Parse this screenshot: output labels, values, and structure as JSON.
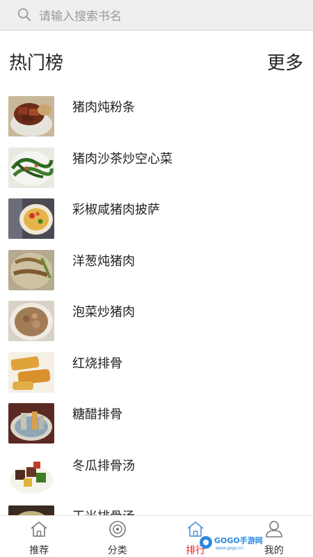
{
  "search": {
    "placeholder": "请输入搜索书名",
    "icon": "search-icon"
  },
  "section": {
    "title": "热门榜",
    "more": "更多"
  },
  "list": [
    {
      "title": "猪肉炖粉条",
      "thumb": "stewed-pork-glass-noodles"
    },
    {
      "title": "猪肉沙茶炒空心菜",
      "thumb": "pork-water-spinach"
    },
    {
      "title": "彩椒咸猪肉披萨",
      "thumb": "pepper-pork-pizza"
    },
    {
      "title": "洋葱炖猪肉",
      "thumb": "onion-stewed-pork"
    },
    {
      "title": "泡菜炒猪肉",
      "thumb": "kimchi-pork"
    },
    {
      "title": "红烧排骨",
      "thumb": "braised-ribs"
    },
    {
      "title": "糖醋排骨",
      "thumb": "sweet-sour-ribs"
    },
    {
      "title": "冬瓜排骨汤",
      "thumb": "winter-melon-rib-soup"
    },
    {
      "title": "玉米排骨汤",
      "thumb": "corn-rib-soup"
    }
  ],
  "tabs": [
    {
      "label": "推荐",
      "icon": "home-icon",
      "active": false
    },
    {
      "label": "分类",
      "icon": "disc-icon",
      "active": false
    },
    {
      "label": "排行",
      "icon": "home-icon",
      "active": true
    },
    {
      "label": "我的",
      "icon": "user-icon",
      "active": false
    }
  ],
  "watermark": {
    "text": "GOGO手游网",
    "sub": "www.gogo.cn"
  },
  "colors": {
    "active": "#e02424",
    "text": "#222222",
    "search_bg": "#efefef"
  }
}
